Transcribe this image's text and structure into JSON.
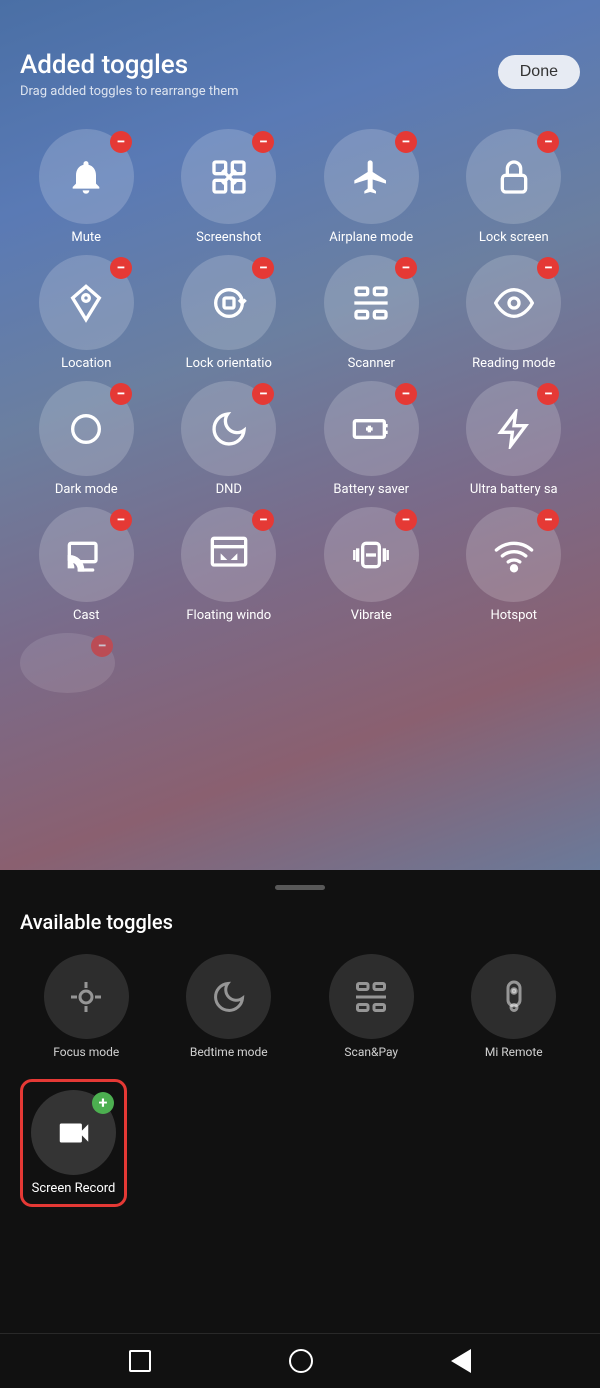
{
  "header": {
    "title": "Added toggles",
    "subtitle": "Drag added toggles to rearrange them",
    "done_label": "Done"
  },
  "added_toggles": [
    {
      "id": "mute",
      "label": "Mute",
      "icon": "bell"
    },
    {
      "id": "screenshot",
      "label": "Screenshot",
      "icon": "screenshot"
    },
    {
      "id": "airplane",
      "label": "Airplane mode",
      "icon": "airplane"
    },
    {
      "id": "lock-screen",
      "label": "Lock screen",
      "icon": "lock"
    },
    {
      "id": "location",
      "label": "Location",
      "icon": "location"
    },
    {
      "id": "lock-orientation",
      "label": "Lock orientatio",
      "icon": "orientation"
    },
    {
      "id": "scanner",
      "label": "Scanner",
      "icon": "scanner"
    },
    {
      "id": "reading-mode",
      "label": "Reading mode",
      "icon": "eye"
    },
    {
      "id": "dark-mode",
      "label": "Dark mode",
      "icon": "dark"
    },
    {
      "id": "dnd",
      "label": "DND",
      "icon": "moon"
    },
    {
      "id": "battery-saver",
      "label": "Battery saver",
      "icon": "battery"
    },
    {
      "id": "ultra-battery",
      "label": "Ultra battery sa",
      "icon": "bolt"
    },
    {
      "id": "cast",
      "label": "Cast",
      "icon": "cast"
    },
    {
      "id": "floating-window",
      "label": "Floating windo",
      "icon": "floating"
    },
    {
      "id": "vibrate",
      "label": "Vibrate",
      "icon": "vibrate"
    },
    {
      "id": "hotspot",
      "label": "Hotspot",
      "icon": "hotspot"
    }
  ],
  "available_section_title": "Available toggles",
  "available_toggles": [
    {
      "id": "focus-mode",
      "label": "Focus mode",
      "icon": "focus"
    },
    {
      "id": "bedtime-mode",
      "label": "Bedtime mode",
      "icon": "bedtime"
    },
    {
      "id": "scan-pay",
      "label": "Scan&Pay",
      "icon": "scanpay"
    },
    {
      "id": "mi-remote",
      "label": "Mi Remote",
      "icon": "remote"
    }
  ],
  "screen_record": {
    "label": "Screen Record",
    "id": "screen-record"
  },
  "nav": {
    "recents": "recents",
    "home": "home",
    "back": "back"
  }
}
